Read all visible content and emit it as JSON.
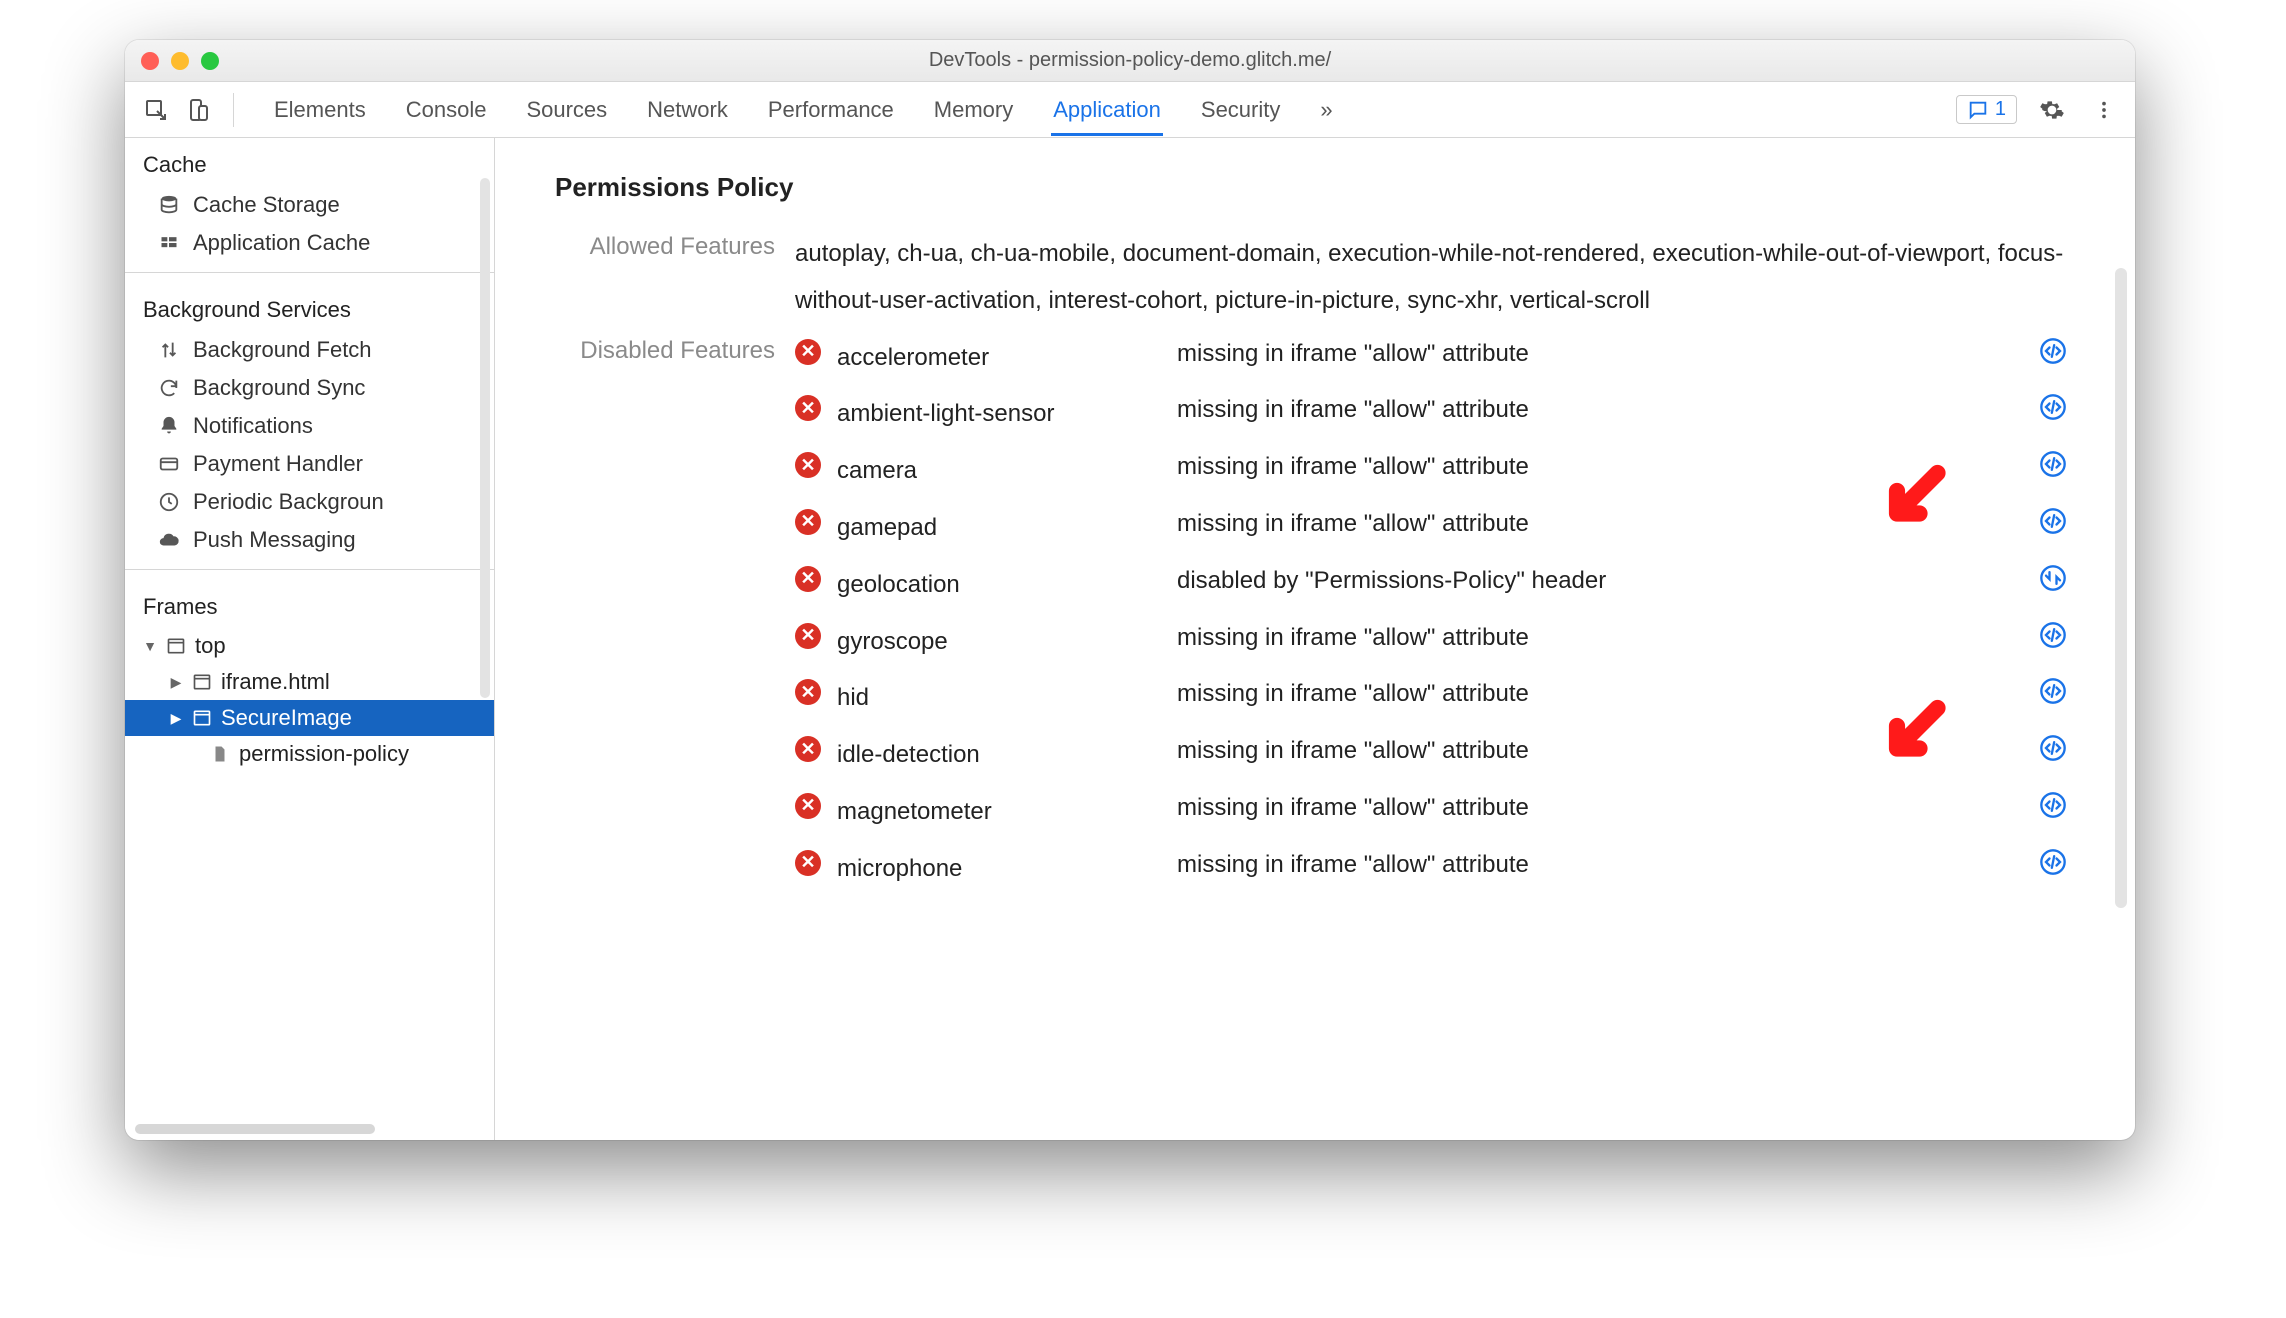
{
  "window": {
    "title": "DevTools - permission-policy-demo.glitch.me/"
  },
  "toolbar": {
    "tabs": [
      "Elements",
      "Console",
      "Sources",
      "Network",
      "Performance",
      "Memory",
      "Application",
      "Security"
    ],
    "active_tab": "Application",
    "issues_count": "1"
  },
  "sidebar": {
    "groups": [
      {
        "title": "Cache",
        "items": [
          {
            "icon": "database",
            "label": "Cache Storage"
          },
          {
            "icon": "grid",
            "label": "Application Cache"
          }
        ]
      },
      {
        "title": "Background Services",
        "items": [
          {
            "icon": "updown",
            "label": "Background Fetch"
          },
          {
            "icon": "sync",
            "label": "Background Sync"
          },
          {
            "icon": "bell",
            "label": "Notifications"
          },
          {
            "icon": "card",
            "label": "Payment Handler"
          },
          {
            "icon": "clock",
            "label": "Periodic Backgroun"
          },
          {
            "icon": "cloud",
            "label": "Push Messaging"
          }
        ]
      }
    ],
    "frames_title": "Frames",
    "tree": {
      "top": "top",
      "children": [
        {
          "label": "iframe.html",
          "selected": false
        },
        {
          "label": "SecureImage",
          "selected": true
        },
        {
          "label": "permission-policy",
          "selected": false,
          "is_file": true
        }
      ]
    }
  },
  "main": {
    "heading": "Permissions Policy",
    "allowed_label": "Allowed Features",
    "allowed_value": "autoplay, ch-ua, ch-ua-mobile, document-domain, execution-while-not-rendered, execution-while-out-of-viewport, focus-without-user-activation, interest-cohort, picture-in-picture, sync-xhr, vertical-scroll",
    "disabled_label": "Disabled Features",
    "disabled": [
      {
        "name": "accelerometer",
        "reason": "missing in iframe \"allow\" attribute",
        "link": "code"
      },
      {
        "name": "ambient-light-sensor",
        "reason": "missing in iframe \"allow\" attribute",
        "link": "code"
      },
      {
        "name": "camera",
        "reason": "missing in iframe \"allow\" attribute",
        "link": "code"
      },
      {
        "name": "gamepad",
        "reason": "missing in iframe \"allow\" attribute",
        "link": "code"
      },
      {
        "name": "geolocation",
        "reason": "disabled by \"Permissions-Policy\" header",
        "link": "net"
      },
      {
        "name": "gyroscope",
        "reason": "missing in iframe \"allow\" attribute",
        "link": "code"
      },
      {
        "name": "hid",
        "reason": "missing in iframe \"allow\" attribute",
        "link": "code"
      },
      {
        "name": "idle-detection",
        "reason": "missing in iframe \"allow\" attribute",
        "link": "code"
      },
      {
        "name": "magnetometer",
        "reason": "missing in iframe \"allow\" attribute",
        "link": "code"
      },
      {
        "name": "microphone",
        "reason": "missing in iframe \"allow\" attribute",
        "link": "code"
      }
    ]
  }
}
